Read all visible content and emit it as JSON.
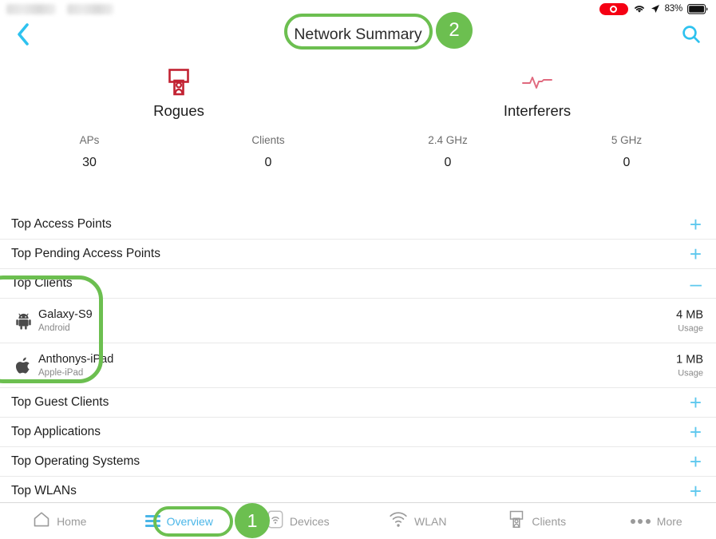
{
  "statusbar": {
    "battery_percent": "83%",
    "recording_icon": "record-indicator",
    "wifi_icon": "wifi-icon",
    "location_icon": "location-arrow-icon",
    "battery_icon": "battery-icon"
  },
  "navbar": {
    "back_icon": "chevron-left-icon",
    "title": "Network Summary",
    "search_icon": "search-icon",
    "accent_color": "#2ec2ef"
  },
  "annotations": {
    "badge_title": "2",
    "badge_overview": "1",
    "highlight_color": "#6cbf50"
  },
  "summary": {
    "panels": [
      {
        "title": "Rogues",
        "icon": "rogue-ap-icon",
        "icon_color": "#c22232",
        "metrics": [
          {
            "label": "APs",
            "value": "30"
          },
          {
            "label": "Clients",
            "value": "0"
          }
        ]
      },
      {
        "title": "Interferers",
        "icon": "interference-waveform-icon",
        "icon_color": "#e0697e",
        "metrics": [
          {
            "label": "2.4 GHz",
            "value": "0"
          },
          {
            "label": "5 GHz",
            "value": "0"
          }
        ]
      }
    ]
  },
  "list": {
    "rows": [
      {
        "label": "Top Access Points",
        "control": "+"
      },
      {
        "label": "Top Pending Access Points",
        "control": "+"
      },
      {
        "label": "Top Clients",
        "control": "–"
      }
    ],
    "clients": [
      {
        "name": "Galaxy-S9",
        "os": "Android",
        "icon": "android-icon",
        "usage_value": "4 MB",
        "usage_label": "Usage"
      },
      {
        "name": "Anthonys-iPad",
        "os": "Apple-iPad",
        "icon": "apple-icon",
        "usage_value": "1 MB",
        "usage_label": "Usage"
      }
    ],
    "rows_after": [
      {
        "label": "Top Guest Clients",
        "control": "+"
      },
      {
        "label": "Top Applications",
        "control": "+"
      },
      {
        "label": "Top Operating Systems",
        "control": "+"
      },
      {
        "label": "Top WLANs",
        "control": "+"
      }
    ]
  },
  "tabbar": {
    "tabs": [
      {
        "label": "Home",
        "icon": "home-icon",
        "active": false
      },
      {
        "label": "Overview",
        "icon": "hamburger-icon",
        "active": true
      },
      {
        "label": "Devices",
        "icon": "access-point-icon",
        "active": false
      },
      {
        "label": "WLAN",
        "icon": "wifi-icon",
        "active": false
      },
      {
        "label": "Clients",
        "icon": "client-icon",
        "active": false
      },
      {
        "label": "More",
        "icon": "ellipsis-icon",
        "active": false
      }
    ],
    "active_color": "#4ab6e8",
    "inactive_color": "#9a9a9a"
  }
}
